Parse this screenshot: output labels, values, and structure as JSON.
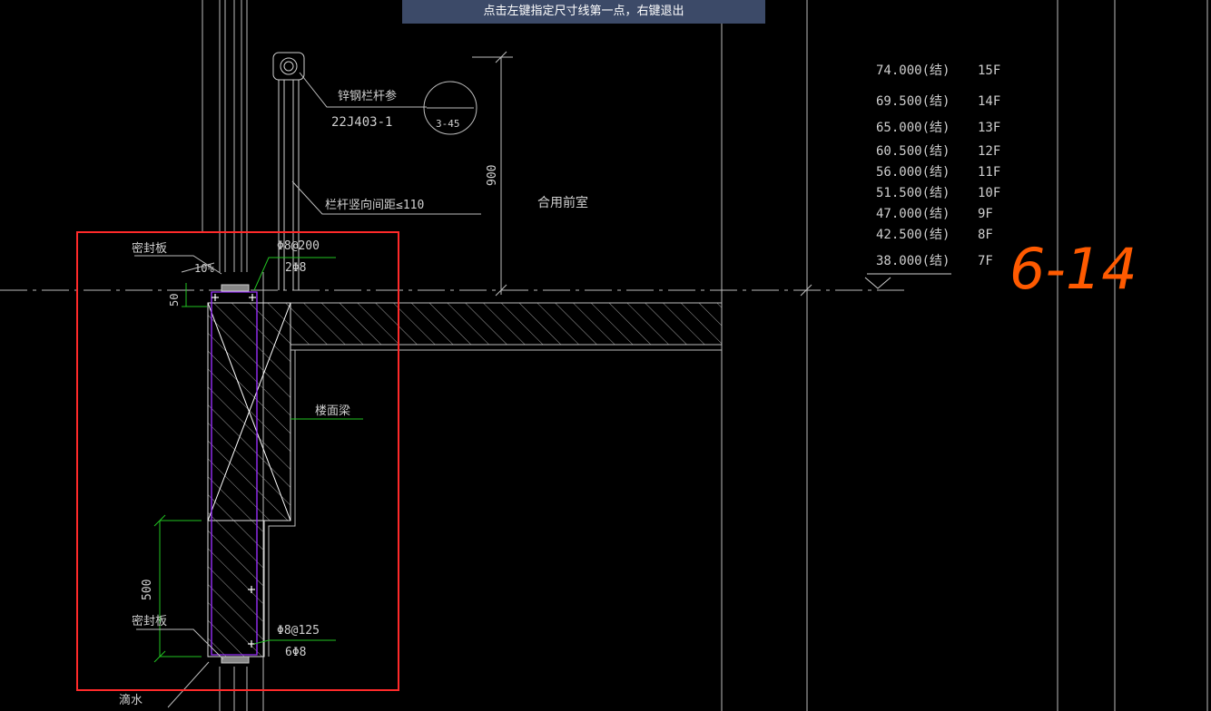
{
  "prompt": "点击左键指定尺寸线第一点，右键退出",
  "colors": {
    "background": "#000000",
    "line": "#bfbfbf",
    "red": "#ff2a2a",
    "green": "#22c322",
    "purple": "#9b30ff",
    "handwriting": "#ff5a00"
  },
  "annotations": {
    "railing_label": "锌钢栏杆参",
    "railing_ref": "22J403-1",
    "detail_ref": "3-45",
    "railing_gap": "栏杆竖向间距≤110",
    "dim_900": "900",
    "room": "合用前室",
    "seal_plate_top": "密封板",
    "slope": "10%",
    "dim_50": "50",
    "rebar_top_1": "Φ8@200",
    "rebar_top_2": "2Φ8",
    "beam_label": "楼面梁",
    "dim_500": "500",
    "seal_plate_bottom": "密封板",
    "rebar_bottom_1": "Φ8@125",
    "rebar_bottom_2": "6Φ8",
    "drip": "滴水"
  },
  "levels": [
    {
      "elev": "74.000(结)",
      "floor": "15F"
    },
    {
      "elev": "69.500(结)",
      "floor": "14F"
    },
    {
      "elev": "65.000(结)",
      "floor": "13F"
    },
    {
      "elev": "60.500(结)",
      "floor": "12F"
    },
    {
      "elev": "56.000(结)",
      "floor": "11F"
    },
    {
      "elev": "51.500(结)",
      "floor": "10F"
    },
    {
      "elev": "47.000(结)",
      "floor": "9F"
    },
    {
      "elev": "42.500(结)",
      "floor": "8F"
    },
    {
      "elev": "38.000(结)",
      "floor": "7F"
    }
  ],
  "handwriting": "6-14"
}
